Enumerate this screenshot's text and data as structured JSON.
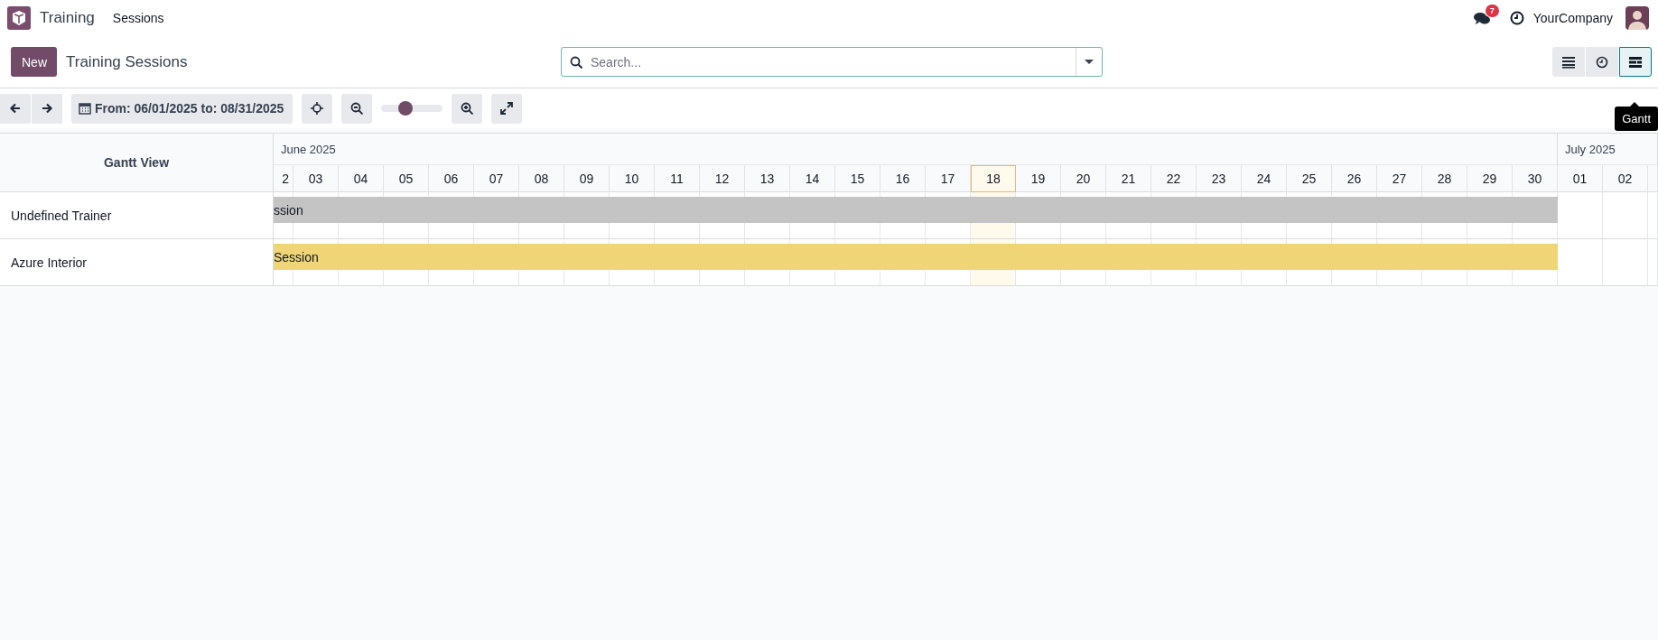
{
  "navbar": {
    "app": "Training",
    "menu": [
      {
        "label": "Sessions"
      }
    ],
    "messages_badge": "7",
    "company": "YourCompany"
  },
  "control_panel": {
    "new_button": "New",
    "breadcrumb": "Training Sessions",
    "search": {
      "placeholder": "Search..."
    },
    "views": [
      {
        "kind": "list",
        "selected": false
      },
      {
        "kind": "activity",
        "selected": false
      },
      {
        "kind": "gantt",
        "selected": true
      }
    ],
    "tooltip": "Gantt"
  },
  "toolbar": {
    "range": "From: 06/01/2025 to: 08/31/2025",
    "zoom": {
      "level": 0.39
    }
  },
  "gantt": {
    "title": "Gantt View",
    "months": [
      {
        "label": "June 2025",
        "days": [
          {
            "kind": "partial",
            "label": "2",
            "today": false
          },
          {
            "kind": "day",
            "label": "03",
            "today": false
          },
          {
            "kind": "day",
            "label": "04",
            "today": false
          },
          {
            "kind": "day",
            "label": "05",
            "today": false
          },
          {
            "kind": "day",
            "label": "06",
            "today": false
          },
          {
            "kind": "day",
            "label": "07",
            "today": false
          },
          {
            "kind": "day",
            "label": "08",
            "today": false
          },
          {
            "kind": "day",
            "label": "09",
            "today": false
          },
          {
            "kind": "day",
            "label": "10",
            "today": false
          },
          {
            "kind": "day",
            "label": "11",
            "today": false
          },
          {
            "kind": "day",
            "label": "12",
            "today": false
          },
          {
            "kind": "day",
            "label": "13",
            "today": false
          },
          {
            "kind": "day",
            "label": "14",
            "today": false
          },
          {
            "kind": "day",
            "label": "15",
            "today": false
          },
          {
            "kind": "day",
            "label": "16",
            "today": false
          },
          {
            "kind": "day",
            "label": "17",
            "today": false
          },
          {
            "kind": "day",
            "label": "18",
            "today": true
          },
          {
            "kind": "day",
            "label": "19",
            "today": false
          },
          {
            "kind": "day",
            "label": "20",
            "today": false
          },
          {
            "kind": "day",
            "label": "21",
            "today": false
          },
          {
            "kind": "day",
            "label": "22",
            "today": false
          },
          {
            "kind": "day",
            "label": "23",
            "today": false
          },
          {
            "kind": "day",
            "label": "24",
            "today": false
          },
          {
            "kind": "day",
            "label": "25",
            "today": false
          },
          {
            "kind": "day",
            "label": "26",
            "today": false
          },
          {
            "kind": "day",
            "label": "27",
            "today": false
          },
          {
            "kind": "day",
            "label": "28",
            "today": false
          },
          {
            "kind": "day",
            "label": "29",
            "today": false
          },
          {
            "kind": "day",
            "label": "30",
            "today": false
          }
        ]
      },
      {
        "label": "July 2025",
        "days": [
          {
            "kind": "day",
            "label": "01",
            "today": false
          },
          {
            "kind": "day",
            "label": "02",
            "today": false
          },
          {
            "kind": "edge",
            "today": false
          }
        ]
      }
    ],
    "rows": [
      {
        "name": "Undefined Trainer",
        "bar": {
          "label": "ssion",
          "color": "#c4c4c4"
        }
      },
      {
        "name": "Azure Interior",
        "bar": {
          "label": "Session",
          "color": "#f0d576"
        }
      }
    ]
  }
}
